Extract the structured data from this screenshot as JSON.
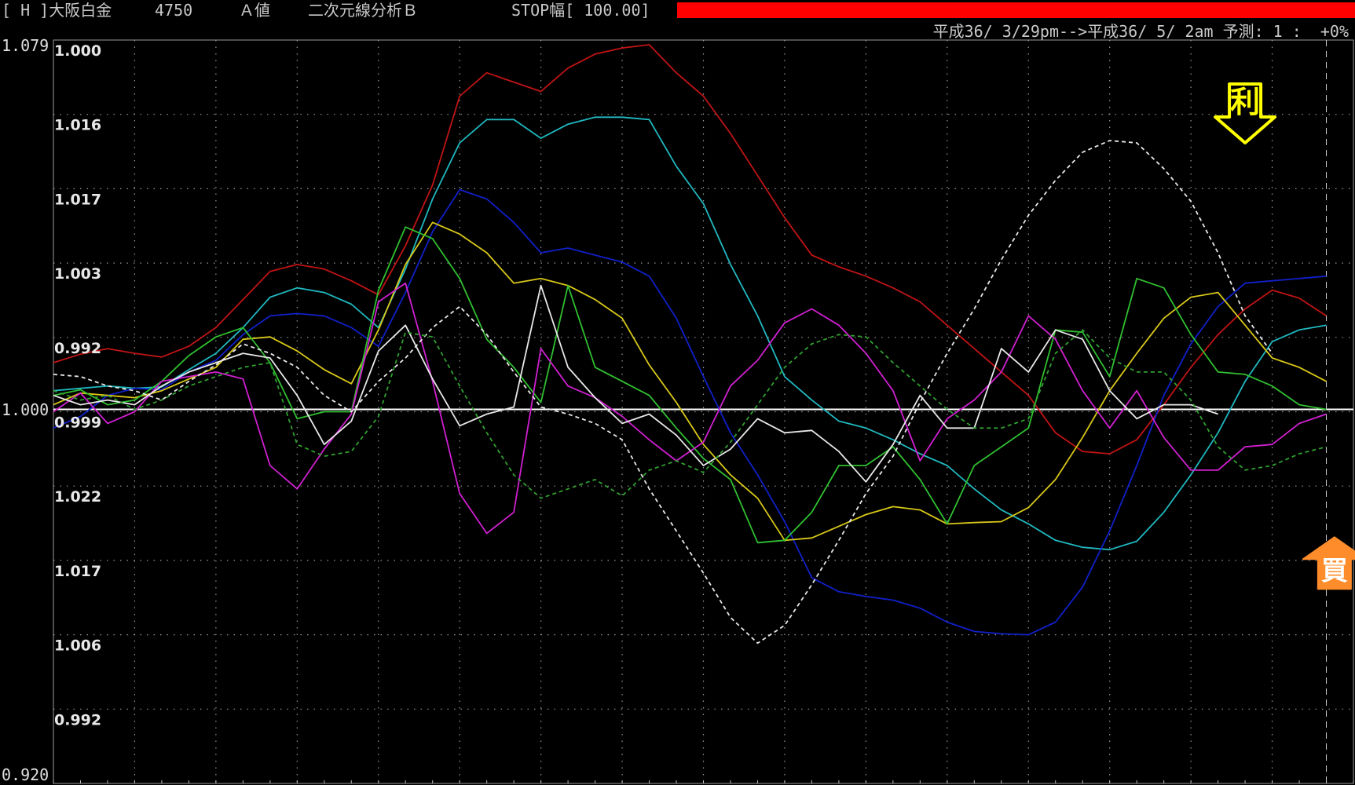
{
  "header": {
    "code": "[ H ]大阪白金",
    "price": "4750",
    "value_type": "Ａ値",
    "analysis": "二次元線分析Ｂ",
    "stop": "STOP幅[ 100.00]",
    "period": "平成36/ 3/29pm-->平成36/ 5/ 2am 予測: 1 :  +0%",
    "red_bar_color": "#ff0000"
  },
  "chart_data": {
    "type": "line",
    "title": "",
    "outer_axis_labels": [
      "1.079",
      "1.000",
      "0.920"
    ],
    "inner_axis_labels": [
      "1.000",
      "1.016",
      "1.017",
      "1.003",
      "0.992",
      "0.999",
      "1.022",
      "1.017",
      "1.006",
      "0.992"
    ],
    "ylim": [
      0.92,
      1.079
    ],
    "xlim": [
      0,
      48
    ],
    "baseline": 1.0,
    "grid": true,
    "signals": [
      {
        "label": "利",
        "type": "sell",
        "color": "#ffff00",
        "x": 44,
        "y": 1.057
      },
      {
        "label": "買",
        "type": "buy",
        "color": "#ff8c2a",
        "x": 47.3,
        "y": 0.972
      }
    ],
    "series": [
      {
        "color": "#c01414",
        "style": "solid",
        "values": [
          1.01,
          1.0118,
          1.013,
          1.012,
          1.0112,
          1.0135,
          1.0175,
          1.0235,
          1.0295,
          1.031,
          1.03,
          1.0275,
          1.0245,
          1.035,
          1.048,
          1.067,
          1.072,
          1.07,
          1.068,
          1.073,
          1.076,
          1.0773,
          1.078,
          1.072,
          1.067,
          1.059,
          1.05,
          1.041,
          1.033,
          1.0305,
          1.0285,
          1.026,
          1.023,
          1.018,
          1.013,
          1.008,
          1.003,
          0.995,
          0.991,
          0.9905,
          0.9935,
          1.001,
          1.009,
          1.016,
          1.0215,
          1.0255,
          1.0238,
          1.02
        ]
      },
      {
        "color": "#20b8c0",
        "style": "solid",
        "values": [
          1.004,
          1.0045,
          1.005,
          1.0045,
          1.0048,
          1.0085,
          1.012,
          1.0175,
          1.024,
          1.026,
          1.025,
          1.0225,
          1.0175,
          1.03,
          1.045,
          1.057,
          1.062,
          1.062,
          1.058,
          1.061,
          1.0625,
          1.0625,
          1.062,
          1.052,
          1.044,
          1.031,
          1.02,
          1.007,
          1.002,
          0.9975,
          0.996,
          0.9935,
          0.9905,
          0.988,
          0.983,
          0.9785,
          0.9755,
          0.972,
          0.9705,
          0.97,
          0.9718,
          0.978,
          0.986,
          0.995,
          1.006,
          1.0145,
          1.017,
          1.018
        ]
      },
      {
        "color": "#1020c8",
        "style": "solid",
        "values": [
          0.996,
          0.9985,
          1.003,
          1.0045,
          1.0042,
          1.008,
          1.0105,
          1.016,
          1.02,
          1.0205,
          1.02,
          1.0175,
          1.0135,
          1.025,
          1.038,
          1.047,
          1.045,
          1.04,
          1.0335,
          1.0345,
          1.033,
          1.0315,
          1.0285,
          1.0195,
          1.007,
          0.995,
          0.986,
          0.976,
          0.964,
          0.961,
          0.96,
          0.9592,
          0.9575,
          0.9545,
          0.9525,
          0.952,
          0.9518,
          0.9545,
          0.962,
          0.974,
          0.988,
          1.003,
          1.014,
          1.022,
          1.027,
          1.0275,
          1.028,
          1.0285
        ]
      },
      {
        "color": "#d8c818",
        "style": "solid",
        "values": [
          1.001,
          1.0035,
          1.003,
          1.0025,
          1.004,
          1.0065,
          1.009,
          1.015,
          1.0155,
          1.0125,
          1.0085,
          1.0055,
          1.017,
          1.031,
          1.04,
          1.0375,
          1.0335,
          1.027,
          1.028,
          1.0265,
          1.0235,
          1.0195,
          1.0095,
          1.0015,
          0.9925,
          0.986,
          0.981,
          0.972,
          0.9725,
          0.975,
          0.9775,
          0.9792,
          0.9785,
          0.9755,
          0.9758,
          0.976,
          0.979,
          0.985,
          0.994,
          1.004,
          1.012,
          1.0195,
          1.024,
          1.025,
          1.018,
          1.011,
          1.009,
          1.006
        ]
      },
      {
        "color": "#30c030",
        "style": "solid",
        "values": [
          1.003,
          1.0042,
          1.001,
          1.002,
          1.006,
          1.0115,
          1.0155,
          1.0175,
          1.01,
          0.998,
          0.9995,
          0.9995,
          1.0255,
          1.039,
          1.0365,
          1.028,
          1.015,
          1.009,
          1.0015,
          1.0265,
          1.009,
          1.006,
          1.003,
          0.996,
          0.9895,
          0.985,
          0.9715,
          0.972,
          0.978,
          0.988,
          0.988,
          0.992,
          0.985,
          0.9755,
          0.988,
          0.992,
          0.996,
          1.017,
          1.0165,
          1.007,
          1.028,
          1.026,
          1.016,
          1.008,
          1.0075,
          1.005,
          1.001,
          1.0
        ]
      },
      {
        "color": "#d020d0",
        "style": "solid",
        "values": [
          0.9995,
          1.0035,
          0.997,
          0.9995,
          1.006,
          1.007,
          1.008,
          1.0065,
          0.988,
          0.983,
          0.9915,
          0.999,
          1.023,
          1.027,
          1.006,
          0.982,
          0.9735,
          0.978,
          1.013,
          1.005,
          1.0025,
          0.9985,
          0.9935,
          0.989,
          0.993,
          1.005,
          1.0105,
          1.0185,
          1.0215,
          1.018,
          1.012,
          1.004,
          0.989,
          0.998,
          1.002,
          1.008,
          1.02,
          1.015,
          1.004,
          0.996,
          1.004,
          0.994,
          0.987,
          0.987,
          0.992,
          0.9925,
          0.997,
          0.999
        ]
      },
      {
        "color": "#e8e8e8",
        "style": "solid",
        "values": [
          1.003,
          1.001,
          1.002,
          1.001,
          1.005,
          1.008,
          1.01,
          1.012,
          1.011,
          1.003,
          0.9925,
          0.9975,
          1.0125,
          1.018,
          1.0065,
          0.9965,
          0.999,
          1.0005,
          1.0265,
          1.009,
          1.0025,
          0.997,
          0.999,
          0.9945,
          0.988,
          0.9915,
          0.998,
          0.995,
          0.9955,
          0.991,
          0.9845,
          0.9925,
          1.003,
          0.996,
          0.996,
          1.013,
          1.008,
          1.017,
          1.015,
          1.004,
          0.998,
          1.001,
          1.001,
          0.999
        ]
      },
      {
        "color": "#e8e8e8",
        "style": "dashed",
        "values": [
          1.0075,
          1.007,
          1.005,
          1.004,
          1.002,
          1.006,
          1.0095,
          1.014,
          1.012,
          1.009,
          1.003,
          0.9995,
          1.006,
          1.011,
          1.0175,
          1.022,
          1.016,
          1.008,
          1.0005,
          0.999,
          0.997,
          0.9935,
          0.983,
          0.974,
          0.965,
          0.9555,
          0.95,
          0.9538,
          0.9625,
          0.972,
          0.982,
          0.99,
          1.0015,
          1.012,
          1.0215,
          1.032,
          1.0415,
          1.049,
          1.055,
          1.0575,
          1.057,
          1.0515,
          1.0445,
          1.0335,
          1.02,
          1.012
        ]
      },
      {
        "color": "#30a030",
        "style": "dashed",
        "values": [
          1.004,
          1.002,
          1.003,
          1.0,
          1.002,
          1.005,
          1.007,
          1.009,
          1.01,
          0.9925,
          0.99,
          0.991,
          0.9985,
          1.0165,
          1.0155,
          1.005,
          0.995,
          0.986,
          0.981,
          0.983,
          0.985,
          0.9815,
          0.987,
          0.989,
          0.9865,
          0.993,
          1.001,
          1.009,
          1.014,
          1.016,
          1.0155,
          1.01,
          1.005,
          1.0,
          0.996,
          0.996,
          0.998,
          1.012,
          1.017,
          1.011,
          1.008,
          1.008,
          1.002,
          0.992,
          0.987,
          0.988,
          0.9905,
          0.992
        ]
      }
    ]
  }
}
